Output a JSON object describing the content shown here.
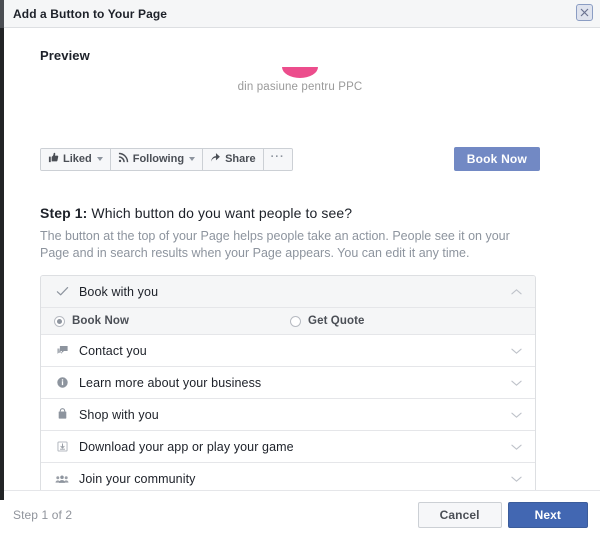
{
  "titlebar": {
    "title": "Add a Button to Your Page",
    "close_icon": "close-icon"
  },
  "preview": {
    "label": "Preview",
    "logo_text": "din pasiune pentru PPC",
    "actions": [
      {
        "label": "Liked",
        "icon": "thumbs-up-icon",
        "has_caret": true
      },
      {
        "label": "Following",
        "icon": "rss-icon",
        "has_caret": true
      },
      {
        "label": "Share",
        "icon": "share-arrow-icon",
        "has_caret": false
      },
      {
        "label": "···",
        "icon": "more-options-icon",
        "has_caret": false
      }
    ],
    "cta_label": "Book Now",
    "cta_color": "#7289c4"
  },
  "step": {
    "heading_bold": "Step 1:",
    "heading_rest": " Which button do you want people to see?",
    "description": "The button at the top of your Page helps people take an action. People see it on your Page and in search results when your Page appears. You can edit it any time."
  },
  "accordion": {
    "items": [
      {
        "label": "Book with you",
        "icon": "check-icon",
        "expanded": true,
        "chevron": "chevron-up-icon"
      },
      {
        "label": "Contact you",
        "icon": "speech-bubble-icon",
        "expanded": false,
        "chevron": "chevron-down-icon"
      },
      {
        "label": "Learn more about your business",
        "icon": "info-circle-icon",
        "expanded": false,
        "chevron": "chevron-down-icon"
      },
      {
        "label": "Shop with you",
        "icon": "shopping-bag-icon",
        "expanded": false,
        "chevron": "chevron-down-icon"
      },
      {
        "label": "Download your app or play your game",
        "icon": "download-box-icon",
        "expanded": false,
        "chevron": "chevron-down-icon"
      },
      {
        "label": "Join your community",
        "icon": "community-people-icon",
        "expanded": false,
        "chevron": "chevron-down-icon"
      }
    ],
    "options": [
      {
        "label": "Book Now",
        "selected": true
      },
      {
        "label": "Get Quote",
        "selected": false
      }
    ]
  },
  "footer": {
    "step_counter": "Step 1 of 2",
    "cancel_label": "Cancel",
    "next_label": "Next",
    "next_color": "#4267b2"
  }
}
